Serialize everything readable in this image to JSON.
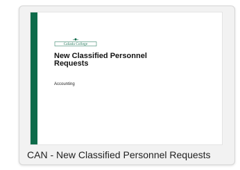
{
  "card": {
    "file_name": "CAN - New Classified Personnel Requests",
    "thumbnail": {
      "logo_text": "Cañada College",
      "title_line1": "New Classified Personnel",
      "title_line2": "Requests",
      "subtitle": "Accounting"
    }
  },
  "colors": {
    "accent": "#0d6b4a",
    "card_background": "#f2f2f2"
  },
  "icons": {
    "logo": "college-seal-icon"
  }
}
